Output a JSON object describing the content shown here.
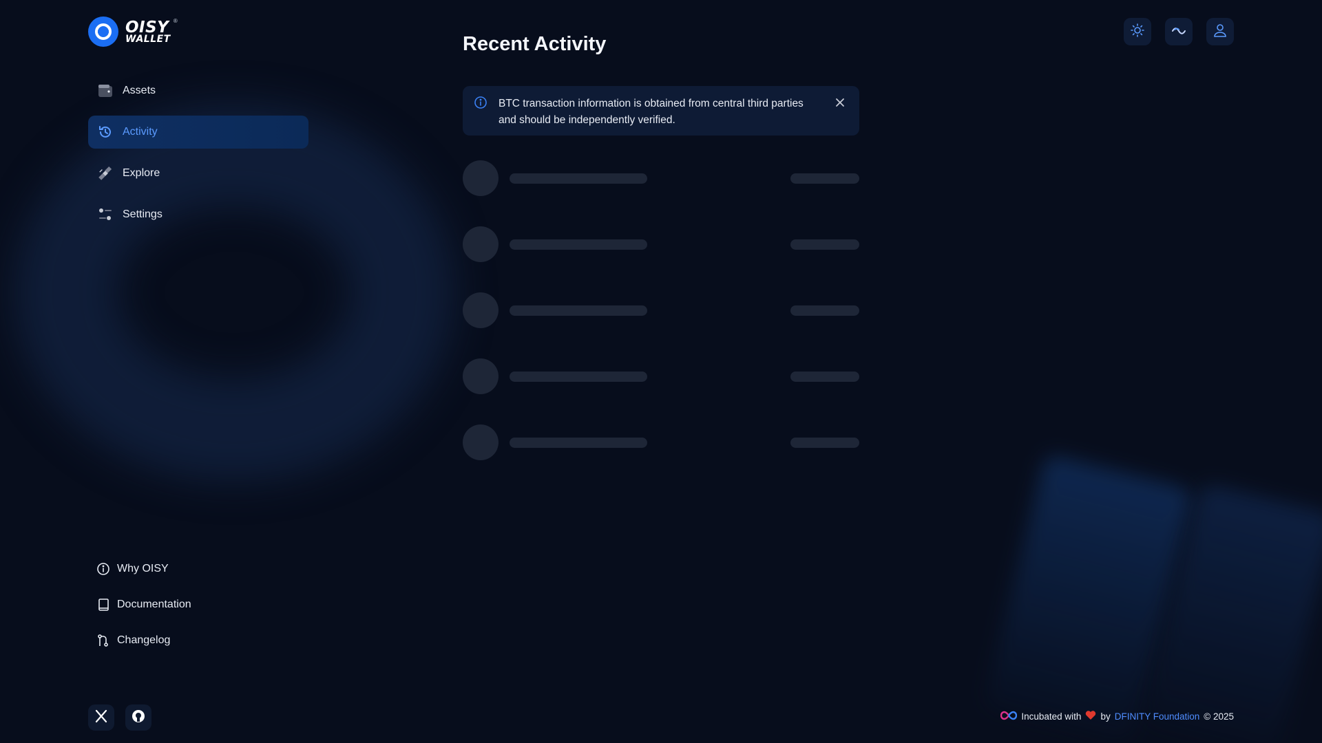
{
  "brand": {
    "line1": "OISY",
    "line2": "WALLET",
    "registered": "®",
    "accent_color": "#1b6ef3"
  },
  "sidebar": {
    "items": [
      {
        "label": "Assets",
        "icon": "wallet-icon",
        "active": false
      },
      {
        "label": "Activity",
        "icon": "history-icon",
        "active": true
      },
      {
        "label": "Explore",
        "icon": "satellite-icon",
        "active": false
      },
      {
        "label": "Settings",
        "icon": "settings-sliders-icon",
        "active": false
      }
    ],
    "footer_links": [
      {
        "label": "Why OISY",
        "icon": "info-circle-icon"
      },
      {
        "label": "Documentation",
        "icon": "book-icon"
      },
      {
        "label": "Changelog",
        "icon": "git-branch-icon"
      }
    ],
    "socials": [
      {
        "icon": "x-twitter-icon"
      },
      {
        "icon": "github-icon"
      }
    ]
  },
  "main": {
    "title": "Recent Activity",
    "alert": {
      "text": "BTC transaction information is obtained from central third parties and should be independently verified.",
      "icon": "info-circle-icon",
      "close_icon": "close-icon"
    },
    "loading_rows": 5
  },
  "top_actions": [
    {
      "icon": "sun-icon",
      "name": "theme-toggle"
    },
    {
      "icon": "waves-icon",
      "name": "network-button"
    },
    {
      "icon": "user-icon",
      "name": "account-button"
    }
  ],
  "footer": {
    "prefix": "Incubated with",
    "by": "by",
    "org": "DFINITY Foundation",
    "copyright": "© 2025",
    "heart_icon": "heart-icon",
    "logo_icon": "infinity-icon"
  }
}
